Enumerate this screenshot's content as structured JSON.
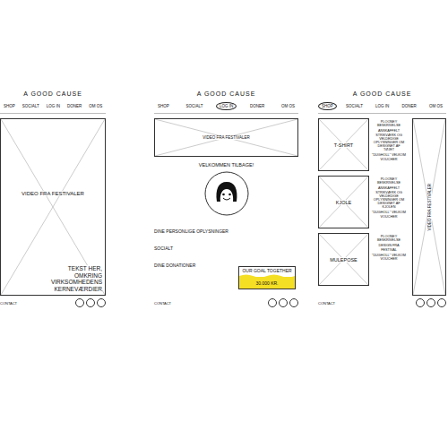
{
  "screens": [
    {
      "kind": "home",
      "title": "A GOOD CAUSE",
      "nav": [
        {
          "label": "SHOP",
          "selected": false
        },
        {
          "label": "SOCIALT",
          "selected": false
        },
        {
          "label": "LOG IN",
          "selected": false
        },
        {
          "label": "DONER",
          "selected": false
        },
        {
          "label": "OM OS",
          "selected": false
        }
      ],
      "video": "VIDEO FRA FESTIVALER",
      "caption": "TEKST HER, OMKRING VIRKSOMHEDENS KERNEVÆRDIER",
      "footer": "CONTACT"
    },
    {
      "kind": "profile",
      "title": "A GOOD CAUSE",
      "nav": [
        {
          "label": "SHOP",
          "selected": false
        },
        {
          "label": "SOCIALT",
          "selected": false
        },
        {
          "label": "LOG IN",
          "selected": true
        },
        {
          "label": "DONER",
          "selected": false
        },
        {
          "label": "OM OS",
          "selected": false
        }
      ],
      "video": "VIDEO FRA FESTIVALER",
      "welcome": "VELKOMMEN TILBAGE!",
      "links": [
        "DINE PERSONLIGE OPLYSNINGER",
        "SOCIALT",
        "DINE DONATIONER"
      ],
      "goal": {
        "label": "OUR GOAL TOGETHER",
        "amount": "30.000 KR."
      },
      "footer": "CONTACT"
    },
    {
      "kind": "shop",
      "title": "A GOOD CAUSE",
      "nav": [
        {
          "label": "SHOP",
          "selected": true
        },
        {
          "label": "SOCIALT",
          "selected": false
        },
        {
          "label": "LOG IN",
          "selected": false
        },
        {
          "label": "DONER",
          "selected": false
        },
        {
          "label": "OM OS",
          "selected": false
        }
      ],
      "products": [
        {
          "name": "T-SHIRT",
          "lines": [
            "PLOONEY BESKRIVELSE",
            "ANSKAFFELT STRIKVÆRK OG VELDEDIGE OPLYSNINGER OM DESIGNET AF TØJET",
            "\"DUGHOLL\" VELKOM VOUCHER"
          ]
        },
        {
          "name": "KJOLE",
          "lines": [
            "PLOONEY BESKRIVELSE",
            "ANSKAFFELT STRIKVÆRK OG VELDEDIGE OPLYSNINGER OM DESIGNET AF KJOLEN",
            "\"DUGHOLL\" VELKOM VOUCHER"
          ]
        },
        {
          "name": "MULEPOSE",
          "lines": [
            "PLOONEY BESKRIVELSE",
            "DESIGN FRA FESTIVAL",
            "\"DUGHOLL\" VELKOM VOUCHER"
          ]
        }
      ],
      "video": "VIDEO FRA FESTIVALER",
      "footer": "CONTACT"
    }
  ]
}
